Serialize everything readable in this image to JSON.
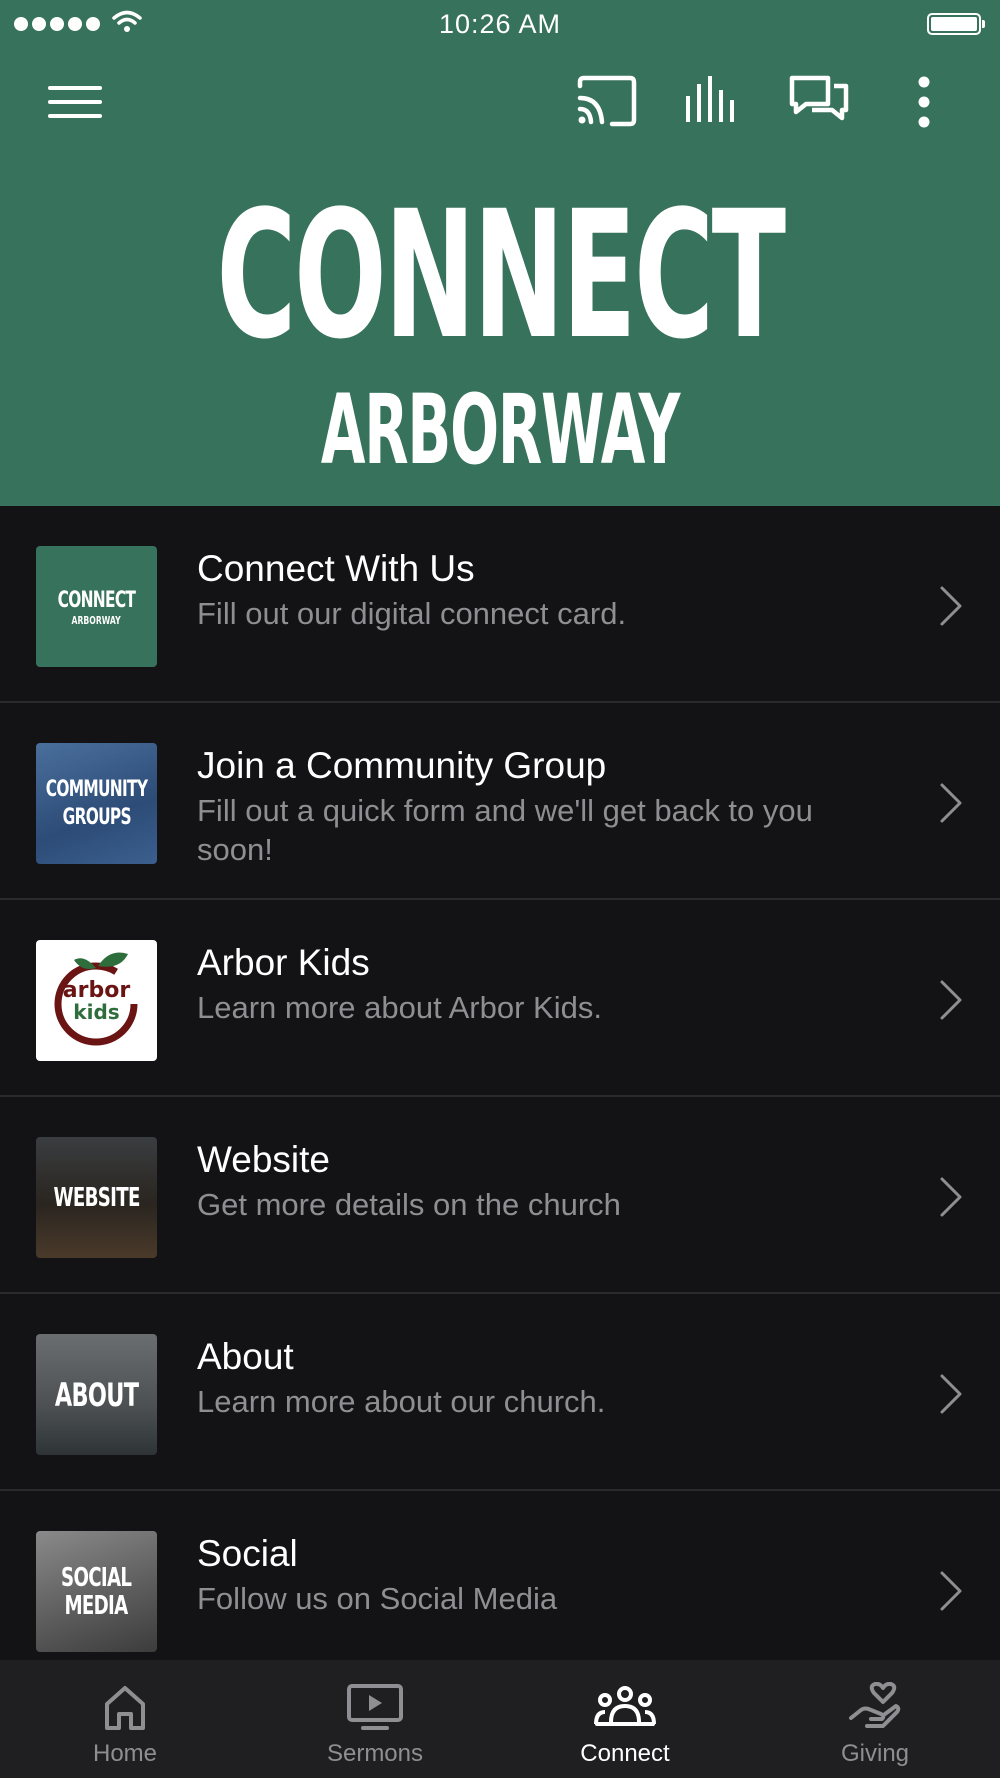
{
  "status_bar": {
    "time": "10:26 AM"
  },
  "hero": {
    "title": "CONNECT",
    "subtitle": "ARBORWAY"
  },
  "items": [
    {
      "title": "Connect With Us",
      "subtitle": "Fill out our digital connect card.",
      "thumb_line1": "CONNECT",
      "thumb_line2": "ARBORWAY"
    },
    {
      "title": "Join a Community Group",
      "subtitle": "Fill out a quick form and we'll get back to you soon!",
      "thumb_line1": "COMMUNITY",
      "thumb_line2": "GROUPS"
    },
    {
      "title": "Arbor Kids",
      "subtitle": "Learn more about Arbor Kids.",
      "thumb_line1": "arbor",
      "thumb_line2": "kids"
    },
    {
      "title": "Website",
      "subtitle": "Get more details on the church",
      "thumb_line1": "WEBSITE"
    },
    {
      "title": "About",
      "subtitle": "Learn more about our church.",
      "thumb_line1": "ABOUT"
    },
    {
      "title": "Social",
      "subtitle": "Follow us on Social Media",
      "thumb_line1": "SOCIAL",
      "thumb_line2": "MEDIA"
    }
  ],
  "tabs": [
    {
      "label": "Home",
      "icon": "home-icon"
    },
    {
      "label": "Sermons",
      "icon": "play-screen-icon"
    },
    {
      "label": "Connect",
      "icon": "people-icon",
      "active": true
    },
    {
      "label": "Giving",
      "icon": "heart-hand-icon"
    }
  ],
  "colors": {
    "header": "#37725C",
    "background": "#131316",
    "tabbar": "#1f1f22",
    "subtitle": "#8e8e93"
  }
}
